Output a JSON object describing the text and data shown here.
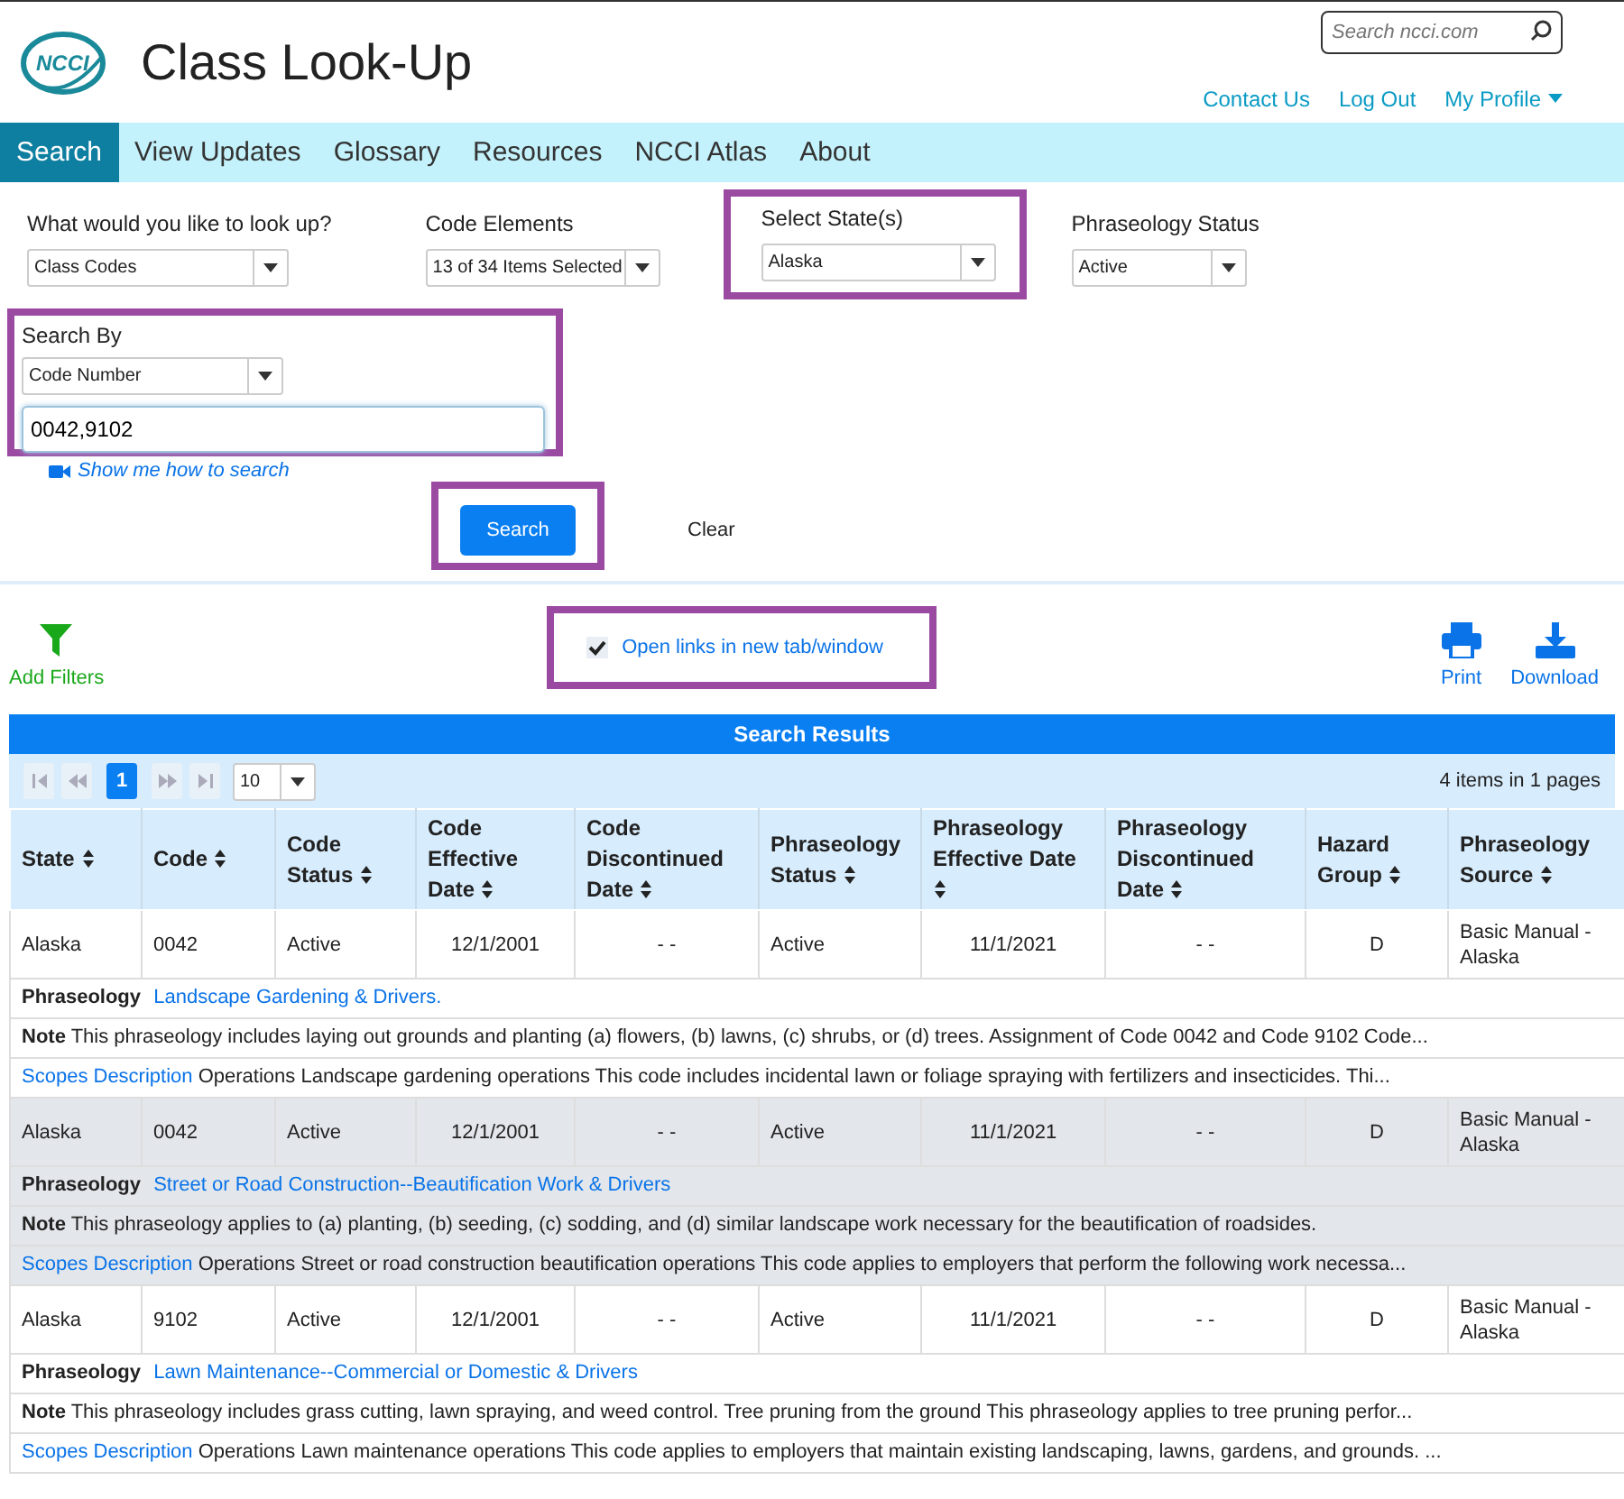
{
  "header": {
    "logo_text": "NCCI",
    "title": "Class Look-Up",
    "search": {
      "placeholder": "Search ncci.com"
    },
    "links": [
      {
        "label": "Contact Us",
        "dropdown": false
      },
      {
        "label": "Log Out",
        "dropdown": false
      },
      {
        "label": "My Profile",
        "dropdown": true
      }
    ]
  },
  "nav": [
    {
      "label": "Search",
      "selected": true
    },
    {
      "label": "View Updates",
      "selected": false
    },
    {
      "label": "Glossary",
      "selected": false
    },
    {
      "label": "Resources",
      "selected": false
    },
    {
      "label": "NCCI Atlas",
      "selected": false
    },
    {
      "label": "About",
      "selected": false
    }
  ],
  "filters": [
    {
      "label": "What would you like to look up?",
      "value": "Class Codes",
      "highlighted": false
    },
    {
      "label": "Code Elements",
      "value": "13 of 34 Items Selected",
      "highlighted": false
    },
    {
      "label": "Select State(s)",
      "value": "Alaska",
      "highlighted": true
    },
    {
      "label": "Phraseology Status",
      "value": "Active",
      "highlighted": false
    }
  ],
  "search_by": {
    "label": "Search By",
    "value": "Code Number",
    "input": "0042,9102",
    "highlighted": true
  },
  "help_link": "Show me how to search",
  "buttons": [
    {
      "label": "Search",
      "kind": "primary",
      "highlighted": true
    },
    {
      "label": "Clear",
      "kind": "plain",
      "highlighted": false
    }
  ],
  "toolbar": {
    "add_filters": "Add Filters",
    "open_links": {
      "label": "Open links in new tab/window",
      "checked": true,
      "highlighted": true
    },
    "print": "Print",
    "download": "Download"
  },
  "results": {
    "title": "Search Results",
    "pager": {
      "page": "1",
      "page_size": "10",
      "summary": "4 items in 1 pages"
    },
    "columns": [
      "State",
      "Code",
      "Code Status",
      "Code Effective Date",
      "Code Discontinued Date",
      "Phraseology Status",
      "Phraseology Effective Date",
      "Phraseology Discontinued Date",
      "Hazard Group",
      "Phraseology Source"
    ],
    "rows": [
      {
        "shaded": false,
        "cells": [
          "Alaska",
          "0042",
          "Active",
          "12/1/2001",
          "- -",
          "Active",
          "11/1/2021",
          "- -",
          "D",
          "Basic Manual - Alaska"
        ],
        "phraseology_label": "Phraseology",
        "phraseology": "Landscape Gardening & Drivers.",
        "note_label": "Note",
        "note": "This phraseology includes laying out grounds and planting (a) flowers, (b) lawns, (c) shrubs, or (d) trees. Assignment of Code 0042 and Code 9102 Code...",
        "scopes_label": "Scopes Description",
        "scopes": "Operations Landscape gardening operations This code includes incidental lawn or foliage spraying with fertilizers and insecticides. Thi..."
      },
      {
        "shaded": true,
        "cells": [
          "Alaska",
          "0042",
          "Active",
          "12/1/2001",
          "- -",
          "Active",
          "11/1/2021",
          "- -",
          "D",
          "Basic Manual - Alaska"
        ],
        "phraseology_label": "Phraseology",
        "phraseology": "Street or Road Construction--Beautification Work & Drivers",
        "note_label": "Note",
        "note": "This phraseology applies to (a) planting, (b) seeding, (c) sodding, and (d) similar landscape work necessary for the beautification of roadsides.",
        "scopes_label": "Scopes Description",
        "scopes": "Operations Street or road construction beautification operations This code applies to employers that perform the following work necessa..."
      },
      {
        "shaded": false,
        "cells": [
          "Alaska",
          "9102",
          "Active",
          "12/1/2001",
          "- -",
          "Active",
          "11/1/2021",
          "- -",
          "D",
          "Basic Manual - Alaska"
        ],
        "phraseology_label": "Phraseology",
        "phraseology": "Lawn Maintenance--Commercial or Domestic & Drivers",
        "note_label": "Note",
        "note": "This phraseology includes grass cutting, lawn spraying, and weed control. Tree pruning from the ground This phraseology applies to tree pruning perfor...",
        "scopes_label": "Scopes Description",
        "scopes": "Operations Lawn maintenance operations This code applies to employers that maintain existing landscaping, lawns, gardens, and grounds. ..."
      }
    ]
  }
}
